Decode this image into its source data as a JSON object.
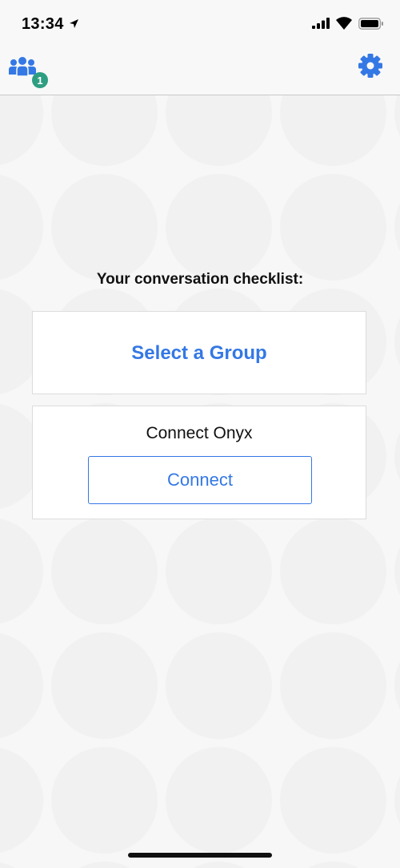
{
  "status_bar": {
    "time": "13:34",
    "icons": [
      "location-arrow-icon",
      "signal-icon",
      "wifi-icon",
      "battery-icon"
    ]
  },
  "nav": {
    "groups_icon": "people-group-icon",
    "badge_count": "1",
    "settings_icon": "gear-icon"
  },
  "checklist": {
    "heading": "Your conversation checklist:",
    "select_group_label": "Select a Group",
    "connect_card_title": "Connect Onyx",
    "connect_button_label": "Connect"
  },
  "colors": {
    "accent": "#3478e5",
    "badge": "#2e9e82"
  }
}
